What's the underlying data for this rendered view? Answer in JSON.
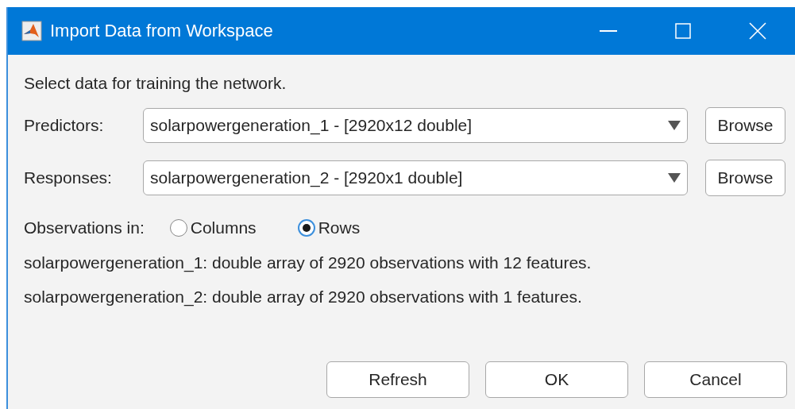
{
  "window": {
    "title": "Import Data from Workspace"
  },
  "instruction": "Select data for training the network.",
  "fields": [
    {
      "label": "Predictors:",
      "value": "solarpowergeneration_1 - [2920x12 double]",
      "button": "Browse"
    },
    {
      "label": "Responses:",
      "value": "solarpowergeneration_2 - [2920x1 double]",
      "button": "Browse"
    }
  ],
  "observations": {
    "label": "Observations in:",
    "options": [
      {
        "label": "Columns",
        "selected": false
      },
      {
        "label": "Rows",
        "selected": true
      }
    ]
  },
  "info": [
    "solarpowergeneration_1: double array of 2920 observations with 12 features.",
    "solarpowergeneration_2: double array of 2920 observations with 1 features."
  ],
  "buttons": [
    "Refresh",
    "OK",
    "Cancel"
  ]
}
